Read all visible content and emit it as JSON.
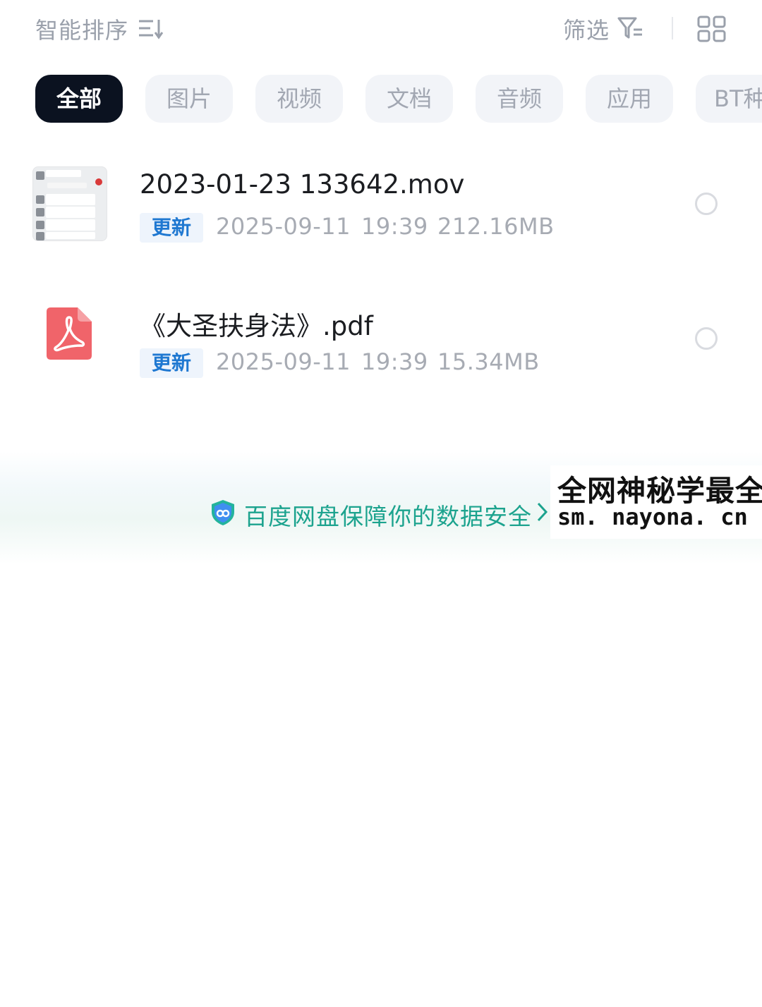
{
  "toolbar": {
    "sort_label": "智能排序",
    "sort_icon": "sort-icon",
    "filter_label": "筛选",
    "filter_icon": "filter-icon",
    "view_icon": "grid-view-icon"
  },
  "categories": [
    {
      "label": "全部",
      "active": true
    },
    {
      "label": "图片",
      "active": false
    },
    {
      "label": "视频",
      "active": false
    },
    {
      "label": "文档",
      "active": false
    },
    {
      "label": "音频",
      "active": false
    },
    {
      "label": "应用",
      "active": false
    },
    {
      "label": "BT种子",
      "active": false
    }
  ],
  "files": [
    {
      "name": "2023-01-23 133642.mov",
      "tag": "更新",
      "date": "2025-09-11",
      "time": "19:39",
      "size": "212.16MB",
      "type_icon": "video-thumbnail"
    },
    {
      "name": "《大圣扶身法》.pdf",
      "tag": "更新",
      "date": "2025-09-11",
      "time": "19:39",
      "size": "15.34MB",
      "type_icon": "pdf-icon"
    }
  ],
  "banner": {
    "text": "百度网盘保障你的数据安全",
    "icon": "shield-icon",
    "arrow": "chevron-right-icon",
    "accent_color": "#1ca38e"
  },
  "watermark": {
    "line1": "全网神秘学最全",
    "line2": "sm. nayona. cn"
  },
  "colors": {
    "active_chip": "#0b1220",
    "tag_text": "#1f78d1",
    "pdf_red": "#f0646a"
  }
}
